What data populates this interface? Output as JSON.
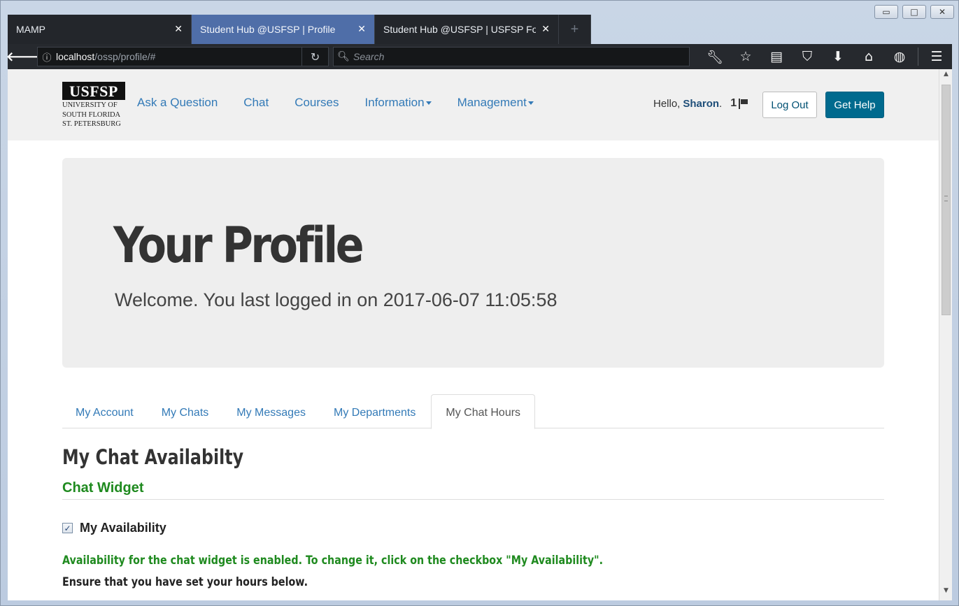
{
  "browser": {
    "window_controls": {
      "minimize": "▭",
      "maximize": "□",
      "close": "✕"
    },
    "tabs": [
      {
        "label": "MAMP",
        "close": "✕"
      },
      {
        "label": "Student Hub @USFSP | Profile",
        "close": "✕"
      },
      {
        "label": "Student Hub @USFSP | USFSP Fo",
        "close": "✕"
      }
    ],
    "new_tab": "+",
    "url_host": "localhost",
    "url_path": "/ossp/profile/#",
    "search_placeholder": "Search",
    "toolbar_icons": [
      "wrench-icon",
      "star-icon",
      "reading-list-icon",
      "pocket-icon",
      "download-icon",
      "home-icon",
      "extension-icon",
      "menu-icon"
    ]
  },
  "header": {
    "logo_mark": "USFSP",
    "logo_lines": [
      "UNIVERSITY OF",
      "SOUTH FLORIDA",
      "ST. PETERSBURG"
    ],
    "nav": [
      {
        "label": "Ask a Question"
      },
      {
        "label": "Chat"
      },
      {
        "label": "Courses"
      },
      {
        "label": "Information",
        "dropdown": true
      },
      {
        "label": "Management",
        "dropdown": true
      }
    ],
    "greeting": "Hello,",
    "username": "Sharon",
    "username_suffix": ".",
    "notifications_count": "1",
    "logout_label": "Log Out",
    "help_label": "Get Help"
  },
  "jumbotron": {
    "title": "Your Profile",
    "welcome": "Welcome. You last logged in on 2017-06-07 11:05:58"
  },
  "profile_tabs": [
    {
      "label": "My Account",
      "active": false
    },
    {
      "label": "My Chats",
      "active": false
    },
    {
      "label": "My Messages",
      "active": false
    },
    {
      "label": "My Departments",
      "active": false
    },
    {
      "label": "My Chat Hours",
      "active": true
    }
  ],
  "availability": {
    "title": "My Chat Availabilty",
    "subtitle": "Chat Widget",
    "checkbox_label": "My Availability",
    "checked": true,
    "status_message": "Availability for the chat widget is enabled. To change it, click on the checkbox \"My Availability\".",
    "hint": "Ensure that you have set your hours below."
  },
  "colors": {
    "link": "#337ab7",
    "success": "#1f8a1f",
    "brand_button": "#006a8e",
    "active_tab": "#4f6ea8"
  }
}
